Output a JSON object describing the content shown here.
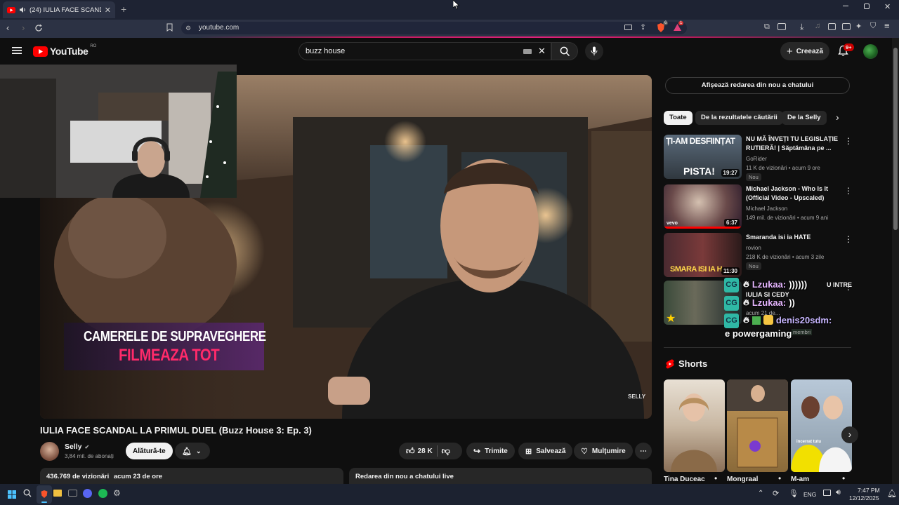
{
  "browser": {
    "tab_title": "(24) IULIA FACE SCANDAL LA",
    "url": "youtube.com",
    "notif_badge_1": "6",
    "notif_badge_2": "1"
  },
  "header": {
    "logo_text": "YouTube",
    "country_code": "RO",
    "search_value": "buzz house",
    "create_label": "Creează",
    "notif_count": "9+"
  },
  "video": {
    "overlay_line1": "CAMERELE DE SUPRAVEGHERE",
    "overlay_line2": "FILMEAZA TOT",
    "watermark": "SELLY",
    "title": "IULIA FACE SCANDAL LA PRIMUL DUEL (Buzz House 3: Ep. 3)"
  },
  "channel": {
    "name": "Selly",
    "subs": "3,84 mil. de abonați",
    "join_label": "Alătură-te",
    "likes": "28 K",
    "share_label": "Trimite",
    "save_label": "Salvează",
    "thanks_label": "Mulțumire"
  },
  "description": {
    "views": "436.769 de vizionări",
    "age": "acum 23 de ore",
    "live_replay": "Redarea din nou a chatului live"
  },
  "sidebar": {
    "chat_replay_button": "Afișează redarea din nou a chatului",
    "chips": [
      "Toate",
      "De la rezultatele căutării",
      "De la Selly"
    ],
    "recs": [
      {
        "title": "NU MĂ ÎNVEȚI TU LEGISLAȚIE RUTIERĂ! | Săptămâna pe ...",
        "channel": "GoRider",
        "meta": "11 K de vizionări • acum 9 ore",
        "badge": "Nou",
        "duration": "19:27",
        "thumb_top": "ȚI-AM DESFIINȚAT",
        "thumb_bottom": "PISTA!"
      },
      {
        "title": "Michael Jackson - Who Is It (Official Video - Upscaled)",
        "channel": "Michael Jackson",
        "meta": "149 mil. de vizionări • acum 9 ani",
        "badge": "",
        "duration": "6:37",
        "thumb_top": "",
        "thumb_bottom": "vevo"
      },
      {
        "title": "Smaranda isi ia HATE",
        "channel": "rovion",
        "meta": "218 K de vizionări • acum 3 zile",
        "badge": "Nou",
        "duration": "11:30",
        "thumb_top": "",
        "thumb_bottom": "SMARA ISI IA H"
      },
      {
        "title": "IULIA SI CEDY",
        "channel": "",
        "meta": "acum 21 de...",
        "badge": "",
        "duration": "1:",
        "thumb_top": "",
        "thumb_bottom": ""
      }
    ],
    "shorts_title": "Shorts",
    "shorts": [
      "Tina Duceac",
      "Mongraal",
      "M-am"
    ],
    "short3_caption": "incerrat tutu"
  },
  "chat_overlay": [
    {
      "user": "Lzukaa:",
      "msg": "))))))"
    },
    {
      "user": "Lzukaa:",
      "msg": "))"
    },
    {
      "user": "denis20sdm:",
      "msg": "e powergaming"
    }
  ],
  "chat_hidden_fragments": {
    "frag_right": "U INTRE",
    "frag_members": "membri"
  },
  "taskbar": {
    "lang": "ENG",
    "time": "7:47 PM",
    "date": "12/12/2025"
  },
  "colors": {
    "yt_red": "#ff0000",
    "accent_pink": "#e0207a",
    "bg": "#0f0f0f"
  }
}
